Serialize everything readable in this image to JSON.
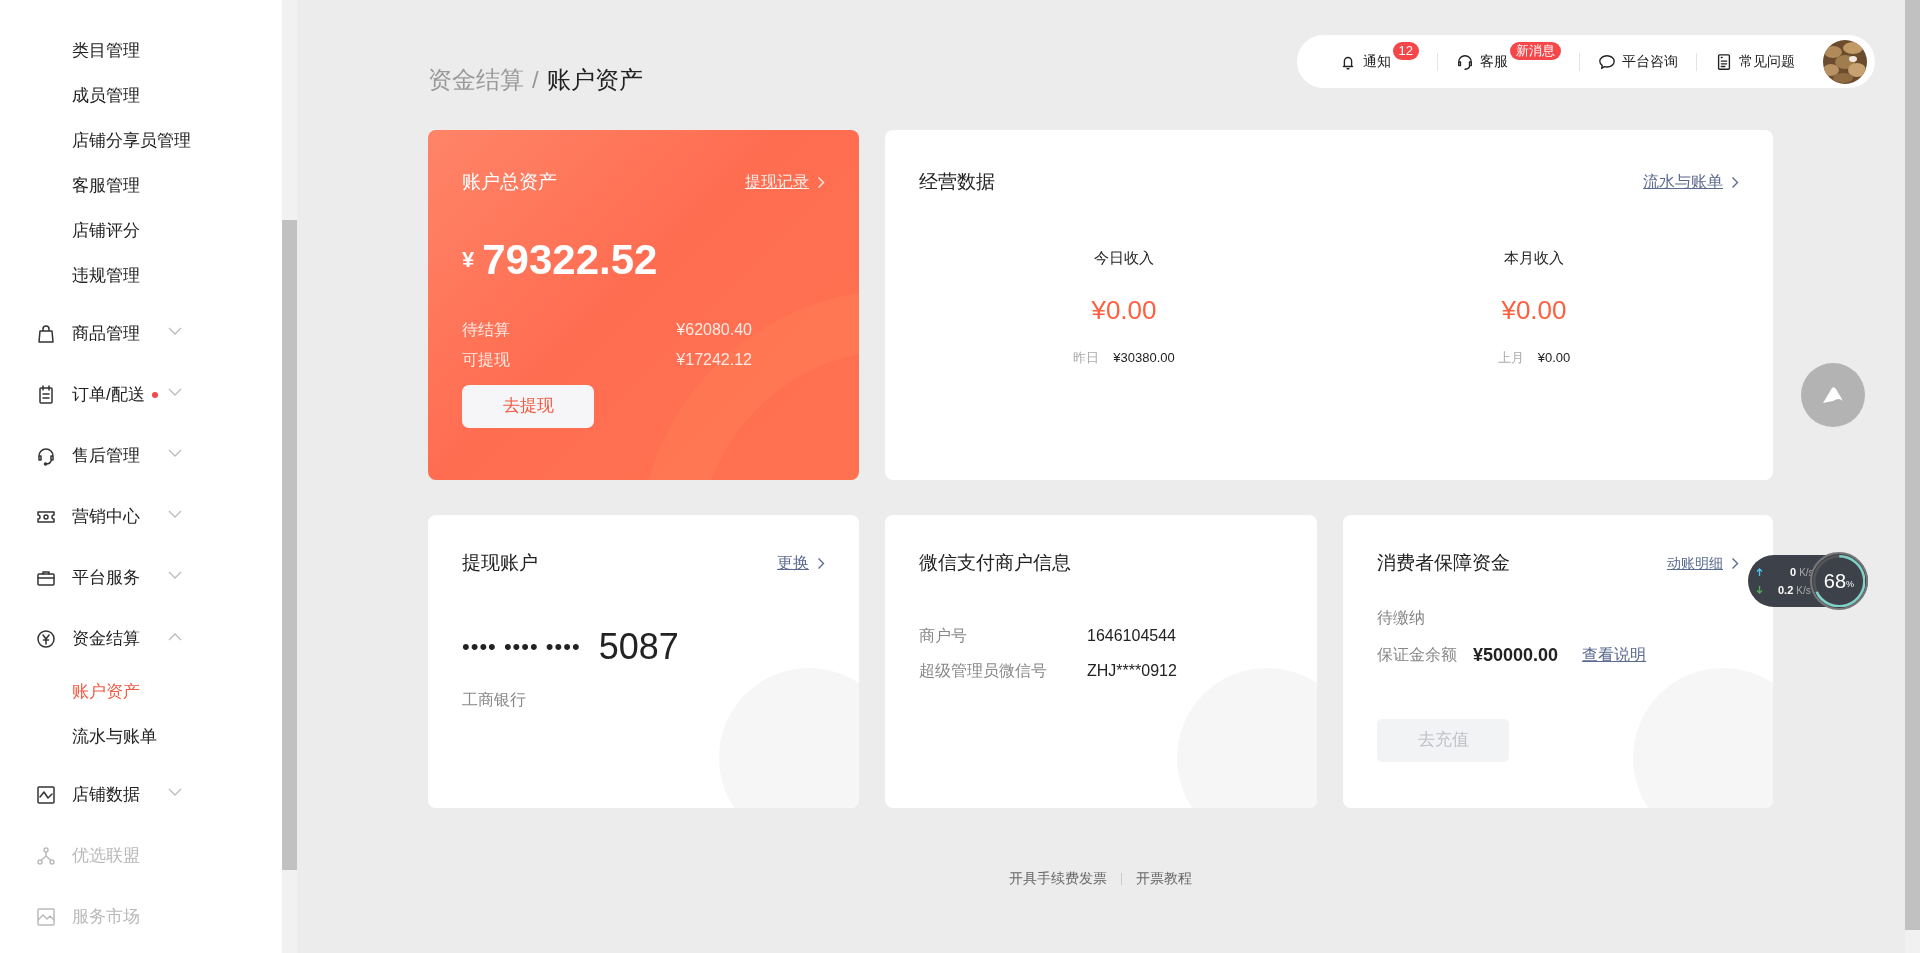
{
  "sidebar": {
    "items": [
      {
        "expanded": true,
        "children": [
          {
            "label": "类目管理",
            "selected": false
          },
          {
            "label": "成员管理",
            "selected": false
          },
          {
            "label": "店铺分享员管理",
            "selected": false
          },
          {
            "label": "客服管理",
            "selected": false
          },
          {
            "label": "店铺评分",
            "selected": false
          },
          {
            "label": "违规管理",
            "selected": false
          }
        ]
      },
      {
        "label": "商品管理",
        "expanded": false,
        "unread": false,
        "disabled": false
      },
      {
        "label": "订单/配送",
        "expanded": false,
        "unread": true,
        "disabled": false
      },
      {
        "label": "售后管理",
        "expanded": false,
        "unread": false,
        "disabled": false
      },
      {
        "label": "营销中心",
        "expanded": false,
        "unread": false,
        "disabled": false
      },
      {
        "label": "平台服务",
        "expanded": false,
        "unread": false,
        "disabled": false
      },
      {
        "label": "资金结算",
        "expanded": true,
        "unread": false,
        "disabled": false,
        "children": [
          {
            "label": "账户资产",
            "selected": true
          },
          {
            "label": "流水与账单",
            "selected": false
          }
        ]
      },
      {
        "label": "店铺数据",
        "expanded": false,
        "unread": false,
        "disabled": false
      },
      {
        "label": "优选联盟",
        "disabled": true
      },
      {
        "label": "服务市场",
        "disabled": true
      }
    ]
  },
  "header": {
    "items": [
      {
        "label": "通知",
        "badge": "12"
      },
      {
        "label": "客服",
        "badge": "新消息"
      },
      {
        "label": "平台咨询"
      },
      {
        "label": "常见问题"
      }
    ]
  },
  "breadcrumb": {
    "items": [
      "资金结算",
      "账户资产"
    ],
    "separator": "/"
  },
  "assets_card": {
    "title": "账户总资产",
    "link": "提现记录",
    "currency": "¥",
    "amount": "79322.52",
    "rows": [
      {
        "label": "待结算",
        "value": "¥62080.40"
      },
      {
        "label": "可提现",
        "value": "¥17242.12"
      }
    ],
    "button": "去提现"
  },
  "operations_card": {
    "title": "经营数据",
    "link": "流水与账单",
    "stats": [
      {
        "label": "今日收入",
        "value": "¥0.00",
        "compare_label": "昨日",
        "compare_value": "¥30380.00"
      },
      {
        "label": "本月收入",
        "value": "¥0.00",
        "compare_label": "上月",
        "compare_value": "¥0.00"
      }
    ]
  },
  "withdraw_card": {
    "title": "提现账户",
    "link": "更换",
    "masked": "•••• •••• ••••",
    "last_digits": "5087",
    "bank": "工商银行"
  },
  "wechat_card": {
    "title": "微信支付商户信息",
    "rows": [
      {
        "label": "商户号",
        "value": "1646104544"
      },
      {
        "label": "超级管理员微信号",
        "value": "ZHJ****0912"
      }
    ]
  },
  "deposit_card": {
    "title": "消费者保障资金",
    "link": "动账明细",
    "status": "待缴纳",
    "balance_label": "保证金余额",
    "balance": "¥50000.00",
    "help_link": "查看说明",
    "button": "去充值",
    "button_disabled": true
  },
  "footer": {
    "links": [
      "开具手续费发票",
      "开票教程"
    ]
  },
  "net_monitor": {
    "upload": "0",
    "upload_unit": "K/s",
    "download": "0.2",
    "download_unit": "K/s",
    "percent": "68",
    "percent_unit": "%"
  }
}
